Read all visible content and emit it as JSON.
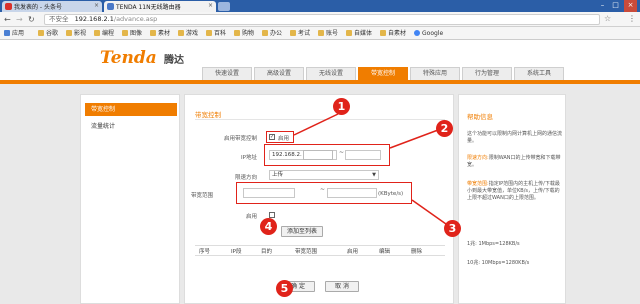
{
  "browser": {
    "tabs": [
      {
        "title": "我发表的 - 头条号"
      },
      {
        "title": "TENDA 11N无线路由器"
      }
    ],
    "security_label": "不安全",
    "url_host": "192.168.2.1",
    "url_path": "/advance.asp",
    "bookmarks": [
      "应用",
      "谷歌",
      "影视",
      "编程",
      "图像",
      "素材",
      "游戏",
      "百科",
      "购物",
      "办公",
      "考试",
      "账号",
      "自媒体",
      "自素材",
      "Google"
    ]
  },
  "router": {
    "logo": "Tenda",
    "logo_cn": "腾达",
    "topnav": [
      "快速设置",
      "高级设置",
      "无线设置",
      "带宽控制",
      "特殊应用",
      "行为管理",
      "系统工具"
    ],
    "active_topnav": "带宽控制",
    "sidebar": [
      "带宽控制",
      "流量统计"
    ],
    "main": {
      "title": "带宽控制",
      "enable_label": "启用带宽控制",
      "enable_text": "启用",
      "ip_label": "IP地址",
      "ip_prefix": "192.168.2.",
      "tilde": "~",
      "direction_label": "限速方向",
      "direction_value": "上传",
      "range_label": "带宽范围",
      "range_unit": "(KByte/s)",
      "enable2_label": "启用",
      "add_button": "添加至列表",
      "table_headers": [
        "序号",
        "IP段",
        "目的",
        "带宽范围",
        "启用",
        "编辑",
        "删除"
      ],
      "ok_button": "确 定",
      "cancel_button": "取 消"
    },
    "help": {
      "title": "帮助信息",
      "p1": "这个功能可以限制内网计算机上网的通信流量。",
      "p2_hl": "限速方向:",
      "p2": "限制WAN口的上传带宽和下载带宽。",
      "p3_hl": "带宽范围:",
      "p3": "指定IP范围内的主机上传/下载最小到最大带宽值，单位KB/s，上传/下载的上限不超过WAN口的上限范围。",
      "p4": "1兆: 1Mbps=128KB/s",
      "p5": "10兆: 10Mbps=1280KB/s"
    },
    "annotations": [
      "1",
      "2",
      "3",
      "4",
      "5"
    ]
  }
}
